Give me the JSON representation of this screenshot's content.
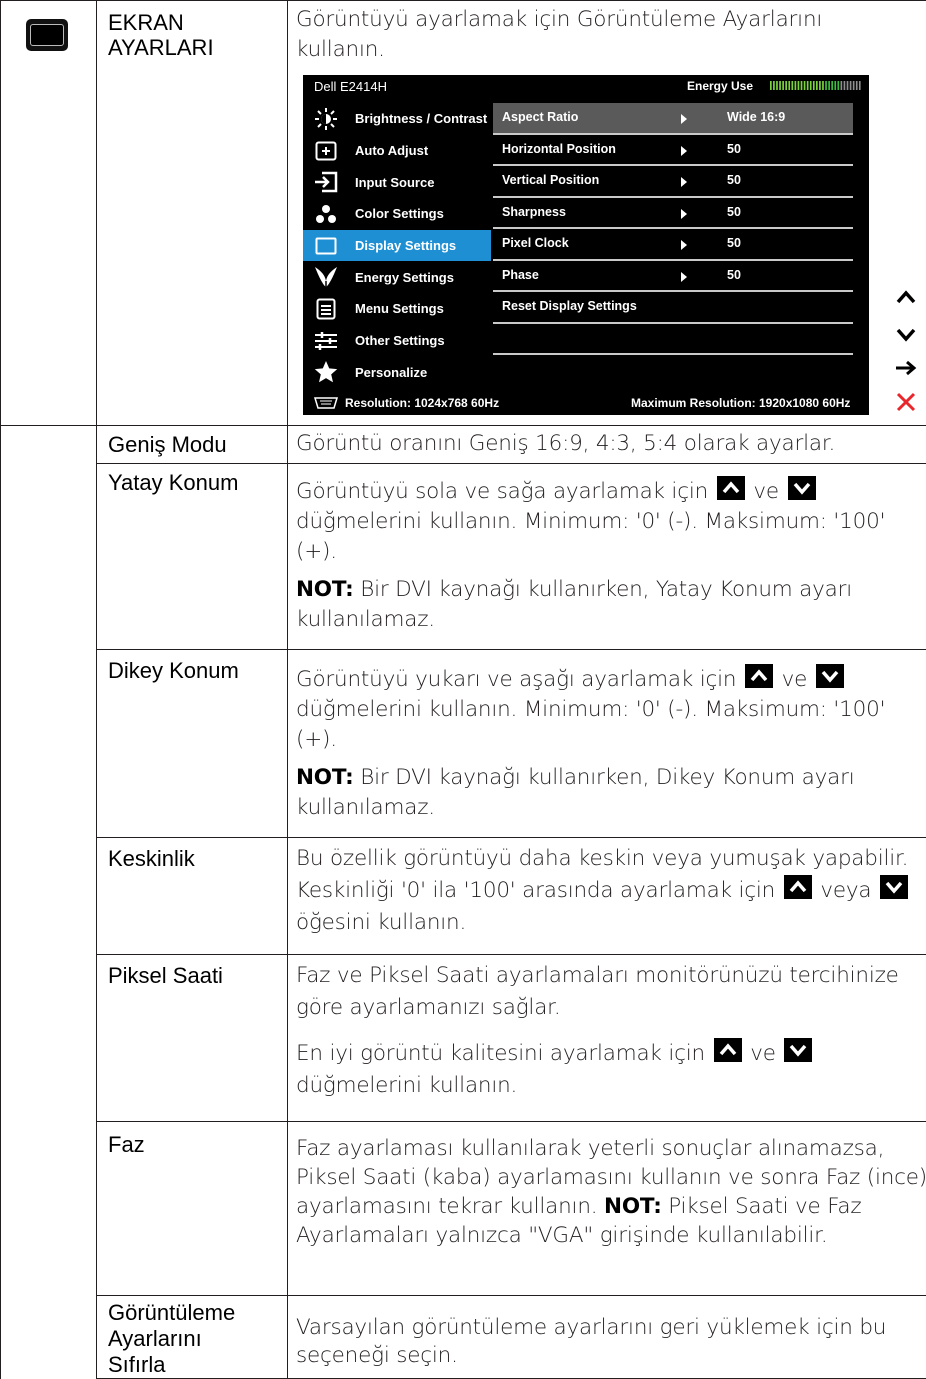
{
  "rows": [
    {
      "name": "EKRAN AYARLARI",
      "desc": "Görüntüyü ayarlamak için Görüntüleme Ayarlarını kullanın."
    },
    {
      "name": "Geniş Modu",
      "desc": "Görüntü oranını Geniş 16:9, 4:3, 5:4 olarak ayarlar."
    },
    {
      "name": "Yatay Konum",
      "desc_a": "Görüntüyü sola ve sağa ayarlamak için",
      "desc_b": "ve",
      "desc_c": "düğmelerini kullanın. Minimum: '0' (-). Maksimum: '100' (+).",
      "note_label": "NOT:",
      "note": "Bir DVI kaynağı kullanırken, Yatay Konum ayarı kullanılamaz."
    },
    {
      "name": "Dikey Konum",
      "desc_a": "Görüntüyü yukarı ve aşağı ayarlamak için",
      "desc_b": "ve",
      "desc_c": "düğmelerini kullanın. Minimum: '0' (-). Maksimum: '100' (+).",
      "note_label": "NOT:",
      "note": "Bir DVI kaynağı kullanırken, Dikey Konum ayarı kullanılamaz."
    },
    {
      "name": "Keskinlik",
      "desc_a": "Bu özellik görüntüyü daha keskin veya yumuşak yapabilir. Keskinliği '0' ila '100' arasında ayarlamak için",
      "desc_b": "veya",
      "desc_c": "öğesini kullanın."
    },
    {
      "name": "Piksel Saati",
      "desc_p1": "Faz ve Piksel Saati ayarlamaları monitörünüzü tercihinize göre ayarlamanızı sağlar.",
      "desc_a": "En iyi görüntü kalitesini ayarlamak için",
      "desc_b": "ve",
      "desc_c": "düğmelerini kullanın."
    },
    {
      "name": "Faz",
      "desc": "Faz ayarlaması kullanılarak yeterli sonuçlar alınamazsa, Piksel Saati (kaba) ayarlamasını kullanın ve sonra Faz (ince) ayarlamasını tekrar kullanın.",
      "note_label": "NOT:",
      "note": "Piksel Saati ve Faz Ayarlamaları yalnızca \"VGA\" girişinde kullanılabilir."
    },
    {
      "name": "Görüntüleme Ayarlarını Sıfırla",
      "desc": "Varsayılan görüntüleme ayarlarını geri yüklemek için bu seçeneği seçin."
    }
  ],
  "osd": {
    "title": "Dell E2414H",
    "energy_label": "Energy Use",
    "energy_level": 0.75,
    "menu": [
      {
        "label": "Brightness / Contrast",
        "icon": "brightness-icon"
      },
      {
        "label": "Auto Adjust",
        "icon": "auto-adjust-icon"
      },
      {
        "label": "Input Source",
        "icon": "input-source-icon"
      },
      {
        "label": "Color Settings",
        "icon": "color-settings-icon"
      },
      {
        "label": "Display Settings",
        "icon": "display-icon",
        "selected": true
      },
      {
        "label": "Energy Settings",
        "icon": "energy-leaf-icon"
      },
      {
        "label": "Menu Settings",
        "icon": "menu-icon"
      },
      {
        "label": "Other Settings",
        "icon": "other-settings-icon"
      },
      {
        "label": "Personalize",
        "icon": "star-icon"
      }
    ],
    "submenu": [
      {
        "label": "Aspect Ratio",
        "value": "Wide 16:9"
      },
      {
        "label": "Horizontal Position",
        "value": "50"
      },
      {
        "label": "Vertical Position",
        "value": "50"
      },
      {
        "label": "Sharpness",
        "value": "50"
      },
      {
        "label": "Pixel Clock",
        "value": "50"
      },
      {
        "label": "Phase",
        "value": "50"
      },
      {
        "label": "Reset Display Settings",
        "value": ""
      }
    ],
    "resolution": "Resolution: 1024x768 60Hz",
    "max_resolution": "Maximum Resolution: 1920x1080 60Hz",
    "accent": "#1f8fd4",
    "exit_color": "#e8262c"
  }
}
